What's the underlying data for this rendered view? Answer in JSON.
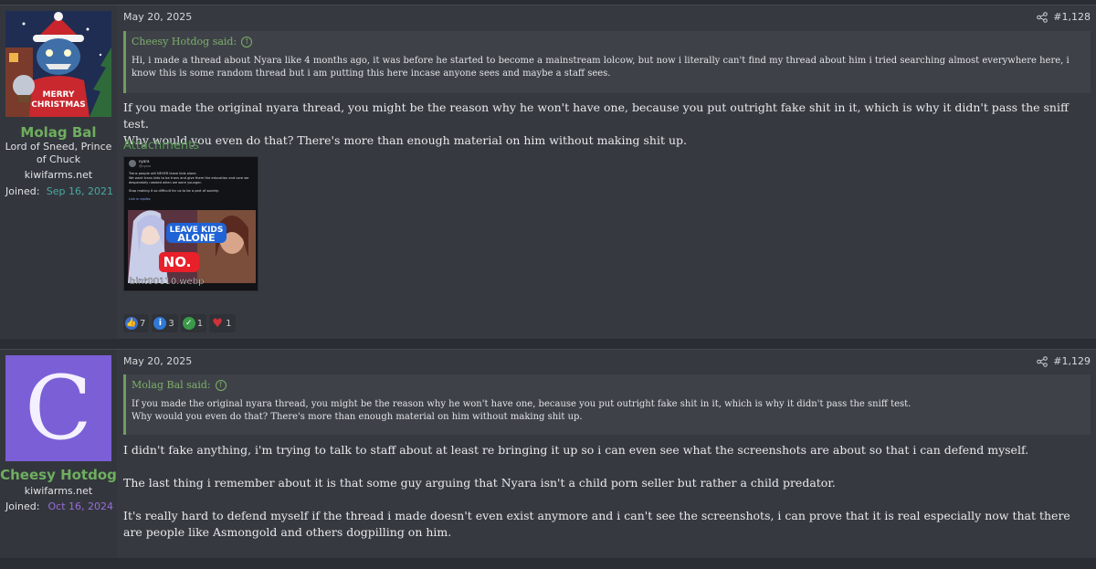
{
  "posts": [
    {
      "author": "Molag Bal",
      "user_title": "Lord of Sneed, Prince of Chuck",
      "banner": "kiwifarms.net",
      "joined_label": "Joined:",
      "joined_date": "Sep 16, 2021",
      "date": "May 20, 2025",
      "post_number": "#1,128",
      "quote": {
        "author_line": "Cheesy Hotdog said:",
        "text_lines": [
          "Hi, i made a thread about Nyara like 4 months ago, it was before he started to become a mainstream lolcow, but now i literally can't find my thread about him i tried searching almost everywhere here, i",
          "know this is some random thread but i am putting this here incase anyone sees and maybe a staff sees."
        ]
      },
      "message_lines": [
        "If you made the original nyara thread, you might be the reason why he won't have one, because you put outright fake shit in it, which is why it didn't pass the sniff test.",
        "Why would you even do that? There's more than enough material on him without making shit up."
      ],
      "attachments_label": "Attachments",
      "attachment": {
        "filename": "bint00110.webp",
        "tweet_name": "nyara",
        "tweet_handle": "@nyara",
        "tweet_lines": [
          "Trans people will NEVER leave kids alone.",
          "We want trans kids to be trans and give them the education and care we",
          "desperately needed when we were younger.",
          "Stop making it so difficult for us to be a part of society.",
          "Link in replies"
        ],
        "banner_line1": "LEAVE KIDS",
        "banner_line2": "ALONE",
        "no_label": "NO."
      },
      "reactions": [
        {
          "icon": "thumbs-up-icon",
          "count": "7",
          "color": "#3a6fd1"
        },
        {
          "icon": "info-icon",
          "count": "3",
          "color": "#2f78d6"
        },
        {
          "icon": "checkmark-icon",
          "count": "1",
          "color": "#3a9a4a"
        },
        {
          "icon": "heart-icon",
          "count": "1",
          "color": "#d0323a"
        }
      ]
    },
    {
      "author": "Cheesy Hotdog",
      "avatar_letter": "C",
      "banner": "kiwifarms.net",
      "joined_label": "Joined:",
      "joined_date": "Oct 16, 2024",
      "date": "May 20, 2025",
      "post_number": "#1,129",
      "quote": {
        "author_line": "Molag Bal said:",
        "text_lines": [
          "If you made the original nyara thread, you might be the reason why he won't have one, because you put outright fake shit in it, which is why it didn't pass the sniff test.",
          "Why would you even do that? There's more than enough material on him without making shit up."
        ]
      },
      "message_paragraphs": [
        "I didn't fake anything, i'm trying to talk to staff about at least re bringing it up so i can even see what the screenshots are about so that i can defend myself.",
        "The last thing i remember about it is that some guy arguing that Nyara isn't a child porn seller but rather a child predator.",
        "It's really hard to defend myself if the thread i made doesn't even exist anymore and i can't see the screenshots, i can prove that it is real especially now that there are people like Asmongold and others dogpilling on him."
      ]
    }
  ]
}
